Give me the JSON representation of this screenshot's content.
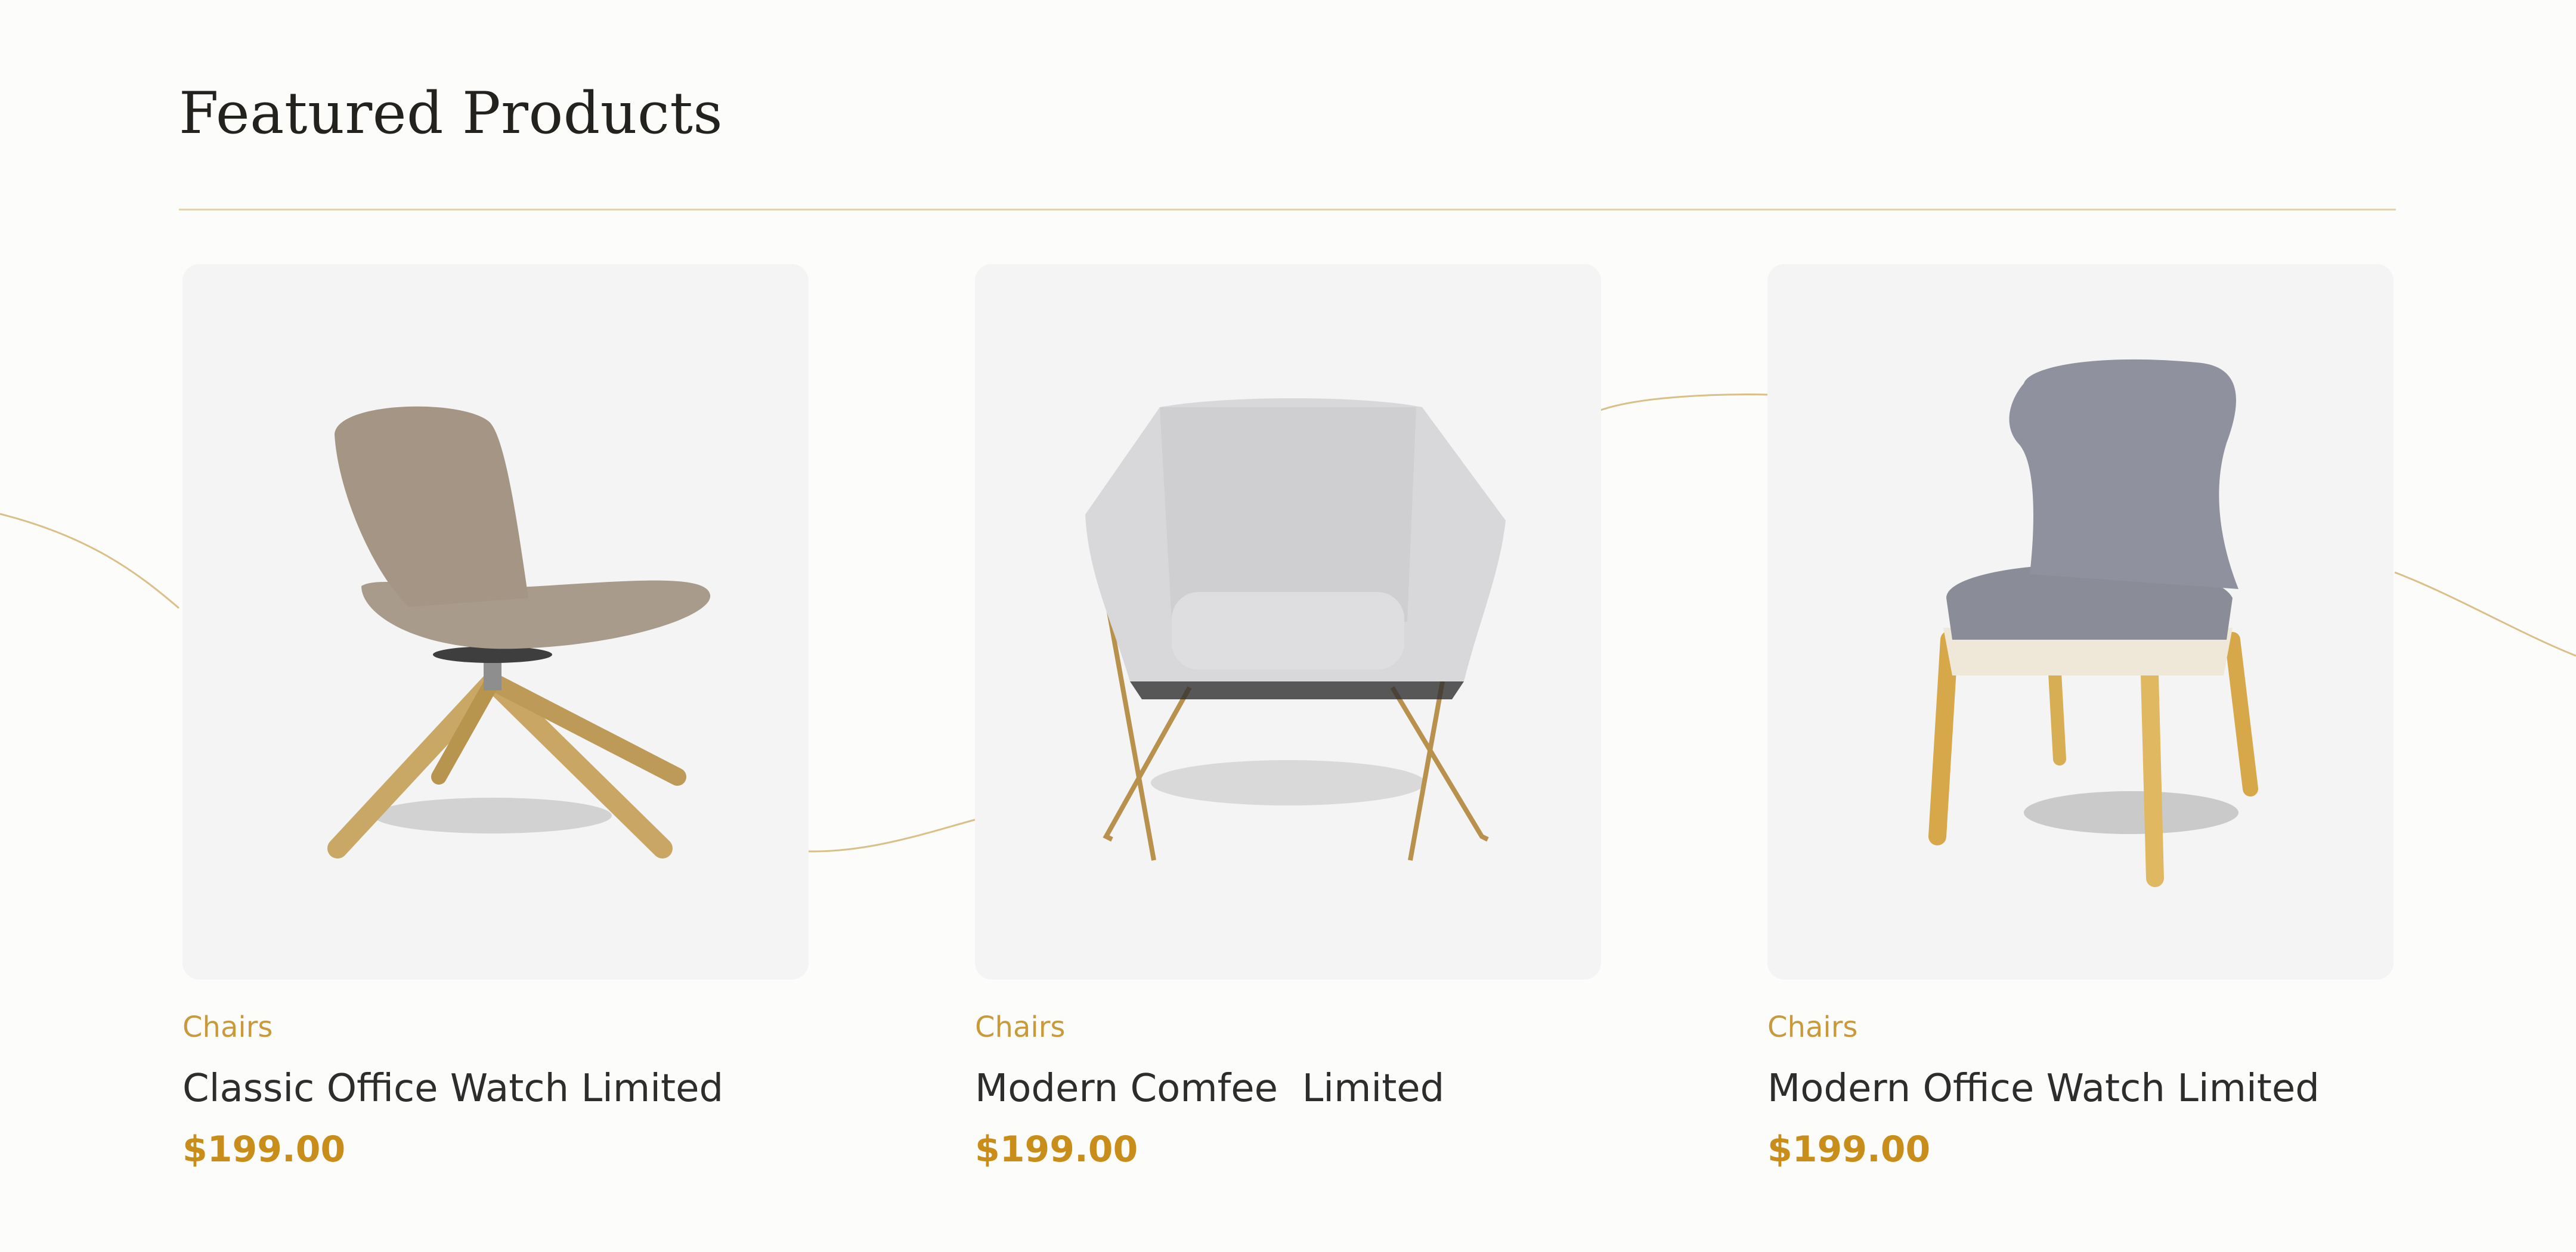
{
  "section": {
    "title": "Featured Products"
  },
  "colors": {
    "accent": "#c98e1a",
    "category": "#c99a3c",
    "divider": "#e2d3b1",
    "card_bg": "#f4f4f5",
    "title_text": "#2d2d2d"
  },
  "products": [
    {
      "image_icon": "swivel-lounge-chair",
      "category": "Chairs",
      "title": "Classic Office Watch Limited",
      "price": "$199.00"
    },
    {
      "image_icon": "armchair",
      "category": "Chairs",
      "title": "Modern Comfee  Limited",
      "price": "$199.00"
    },
    {
      "image_icon": "dining-chair",
      "category": "Chairs",
      "title": "Modern Office Watch Limited",
      "price": "$199.00"
    }
  ]
}
